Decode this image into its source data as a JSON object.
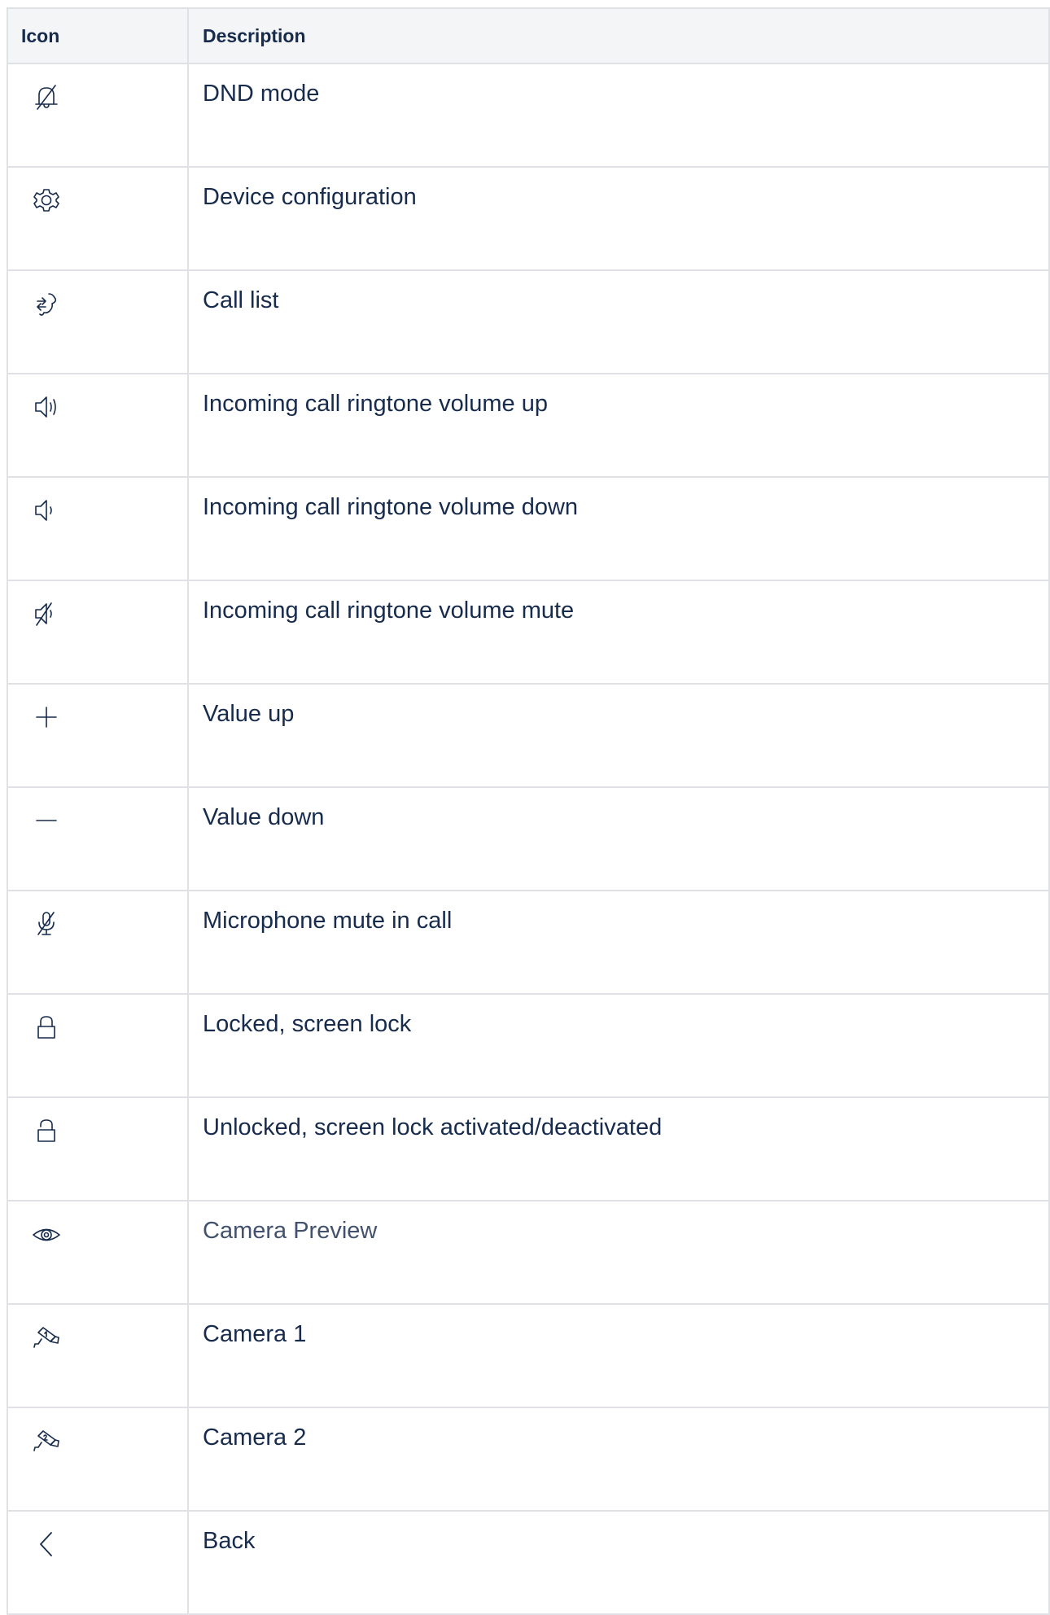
{
  "table": {
    "headers": {
      "icon": "Icon",
      "description": "Description"
    },
    "rows": [
      {
        "icon": "bell-off-icon",
        "description": "DND mode"
      },
      {
        "icon": "gear-icon",
        "description": "Device configuration"
      },
      {
        "icon": "call-list-icon",
        "description": "Call list"
      },
      {
        "icon": "volume-up-icon",
        "description": "Incoming call ringtone volume up"
      },
      {
        "icon": "volume-down-icon",
        "description": "Incoming call ringtone volume down"
      },
      {
        "icon": "volume-mute-icon",
        "description": "Incoming call ringtone volume mute"
      },
      {
        "icon": "plus-icon",
        "description": "Value up"
      },
      {
        "icon": "minus-icon",
        "description": "Value down"
      },
      {
        "icon": "microphone-mute-icon",
        "description": "Microphone mute in call"
      },
      {
        "icon": "lock-icon",
        "description": "Locked, screen lock"
      },
      {
        "icon": "unlock-icon",
        "description": "Unlocked, screen lock activated/deactivated"
      },
      {
        "icon": "eye-icon",
        "description": "Camera Preview"
      },
      {
        "icon": "camera-1-icon",
        "description": "Camera 1"
      },
      {
        "icon": "camera-2-icon",
        "description": "Camera 2"
      },
      {
        "icon": "chevron-left-icon",
        "description": "Back"
      }
    ]
  }
}
